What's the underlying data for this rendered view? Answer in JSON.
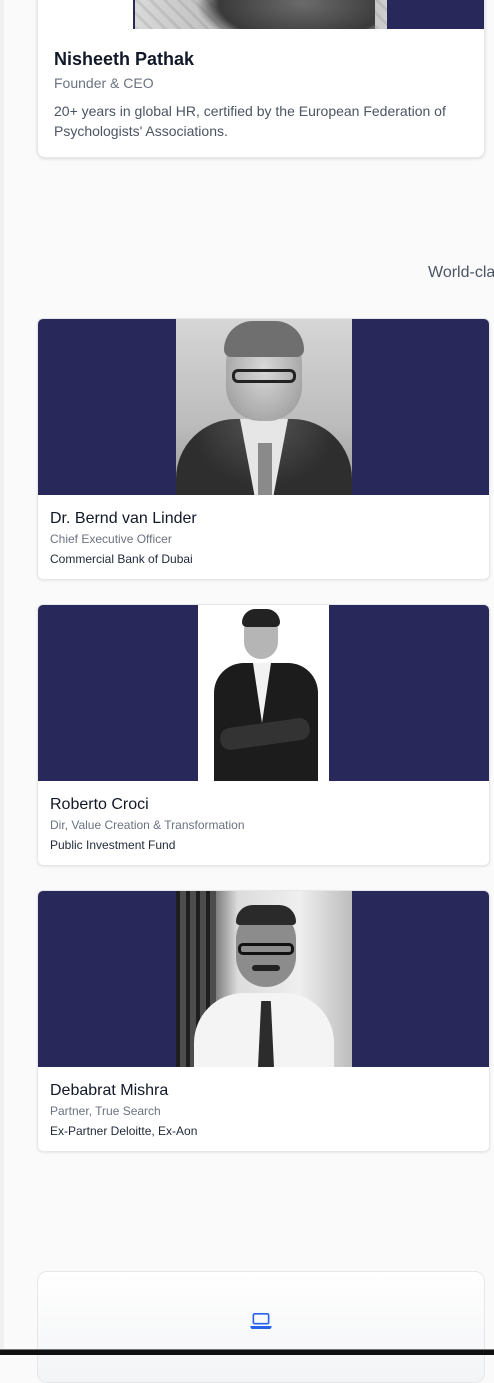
{
  "founder": {
    "name": "Nisheeth Pathak",
    "role": "Founder & CEO",
    "bio": "20+ years in global HR, certified by the European Federation of Psychologists' Associations."
  },
  "section": {
    "tagline": "World-cla"
  },
  "advisors": [
    {
      "name": "Dr. Bernd van Linder",
      "title": "Chief Executive Officer",
      "organization": "Commercial Bank of Dubai"
    },
    {
      "name": "Roberto Croci",
      "title": "Dir, Value Creation & Transformation",
      "organization": "Public Investment Fund"
    },
    {
      "name": "Debabrat Mishra",
      "title": "Partner, True Search",
      "organization": "Ex-Partner Deloitte, Ex-Aon"
    }
  ],
  "feature": {
    "icon": "laptop-icon"
  },
  "colors": {
    "banner": "#29285a",
    "accent_icon": "#2563eb",
    "card_border": "#e5e7eb"
  }
}
